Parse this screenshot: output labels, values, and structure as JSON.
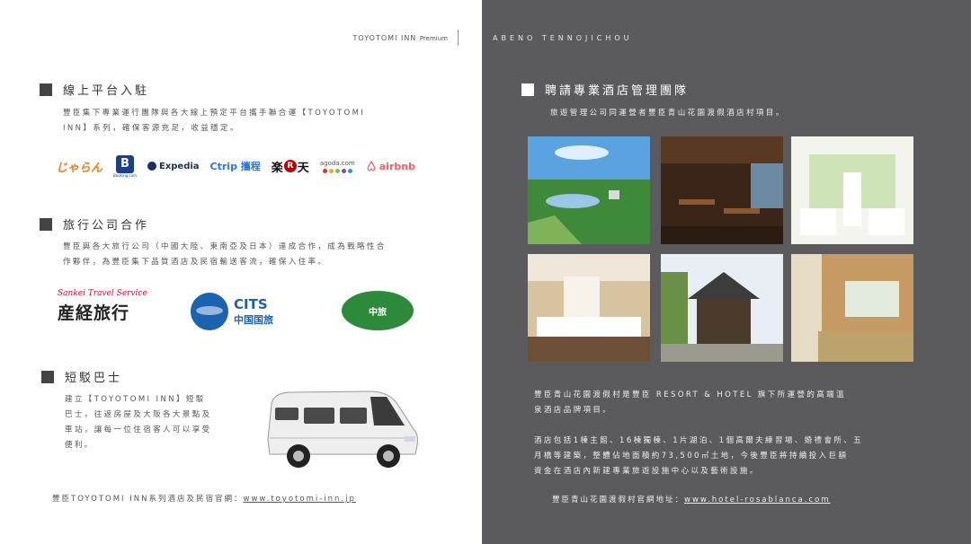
{
  "header": {
    "brand": "TOYOTOMI INN",
    "brand_suffix": "Premium",
    "location": "ABENO TENNOJICHOU"
  },
  "left": {
    "section1": {
      "title": "線上平台入駐",
      "body_line1": "豐臣集下專業運行團隊與各大線上預定平台攜手聯合運【TOYOTOMI",
      "body_line2": "INN】系列，確保客源充足，收益穩定。",
      "logos": [
        {
          "name": "じゃらん",
          "icon": "jalan-logo"
        },
        {
          "name": "B",
          "sub": "Booking.com",
          "icon": "booking-logo"
        },
        {
          "name": "Expedia",
          "icon": "expedia-logo"
        },
        {
          "name": "Ctrip 攜程",
          "icon": "ctrip-logo"
        },
        {
          "name": "楽天",
          "mid": "R",
          "icon": "rakuten-logo"
        },
        {
          "name": "agoda.com",
          "icon": "agoda-logo"
        },
        {
          "name": "airbnb",
          "icon": "airbnb-logo"
        }
      ]
    },
    "section2": {
      "title": "旅行公司合作",
      "body_line1": "豐臣與各大旅行公司（中國大陸、東南亞及日本）達成合作，成為戰略性合",
      "body_line2": "作夥伴，為豐臣集下品質酒店及民宿輸送客流，確保入住率。",
      "logos": {
        "sankei_en": "Sankei Travel Service",
        "sankei_jp": "産経旅行",
        "cits_en": "CITS",
        "cits_cn": "中国国旅",
        "china_travel": "中旅"
      }
    },
    "section3": {
      "title": "短駁巴士",
      "body_line1": "建立【TOYOTOMI INN】短駁",
      "body_line2": "巴士，往返房屋及大阪各大景點及",
      "body_line3": "車站，讓每一位住宿客人可以享受",
      "body_line4": "便利。"
    },
    "footer_prefix": "豐臣TOYOTOMI INN系列酒店及民宿官網：",
    "footer_url": "www.toyotomi-inn.jp"
  },
  "right": {
    "title": "聘請專業酒店管理團隊",
    "subtitle": "旅遊管理公司同運營者豐臣青山花園渡假酒店村項目。",
    "para1_line1": "豐臣青山花園渡假村是豐臣 RESORT & HOTEL 旗下所運營的高端溫",
    "para1_line2": "泉酒店品牌項目。",
    "para2_line1": "酒店包括1棟主館、16棟獨棟、1片湖泊、1個高爾夫練習場、婚禮會所、五",
    "para2_line2": "月橋等建築，整體佔地面積約73,500㎡土地，今後豐臣將持續投入巨額",
    "para2_line3": "資金在酒店內新建專業旅遊設施中心以及藝術設施。",
    "footer_prefix": "豐臣青山花園渡假村官網地址：",
    "footer_url": "www.hotel-rosablanca.com",
    "photos": [
      {
        "icon": "resort-lake-photo"
      },
      {
        "icon": "restaurant-photo"
      },
      {
        "icon": "wedding-chapel-photo"
      },
      {
        "icon": "guest-room-photo"
      },
      {
        "icon": "cottage-photo"
      },
      {
        "icon": "japanese-room-photo"
      }
    ]
  }
}
